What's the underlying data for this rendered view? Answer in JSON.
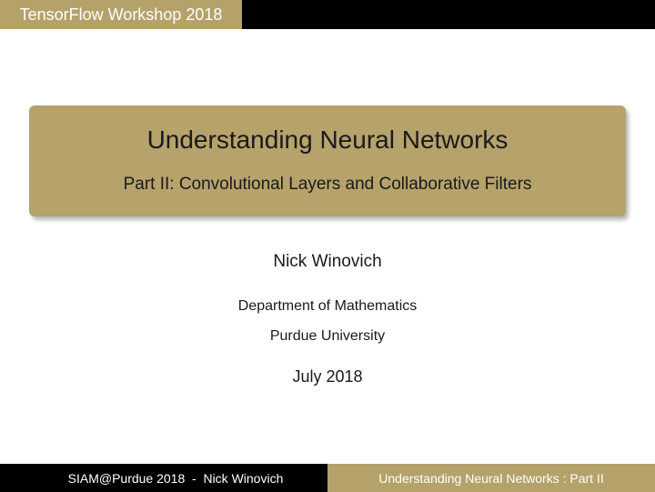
{
  "header": {
    "tab_label": "TensorFlow Workshop 2018"
  },
  "title_block": {
    "title": "Understanding Neural Networks",
    "subtitle": "Part II: Convolutional Layers and Collaborative Filters"
  },
  "author": "Nick Winovich",
  "department": "Department of Mathematics",
  "university": "Purdue University",
  "date": "July 2018",
  "footer": {
    "left_text": "SIAM@Purdue 2018  -  Nick Winovich",
    "right_text": "Understanding Neural Networks : Part II"
  },
  "colors": {
    "accent_gold": "#b5a26a",
    "bar_black": "#000000",
    "text_dark": "#1a1a1a"
  }
}
